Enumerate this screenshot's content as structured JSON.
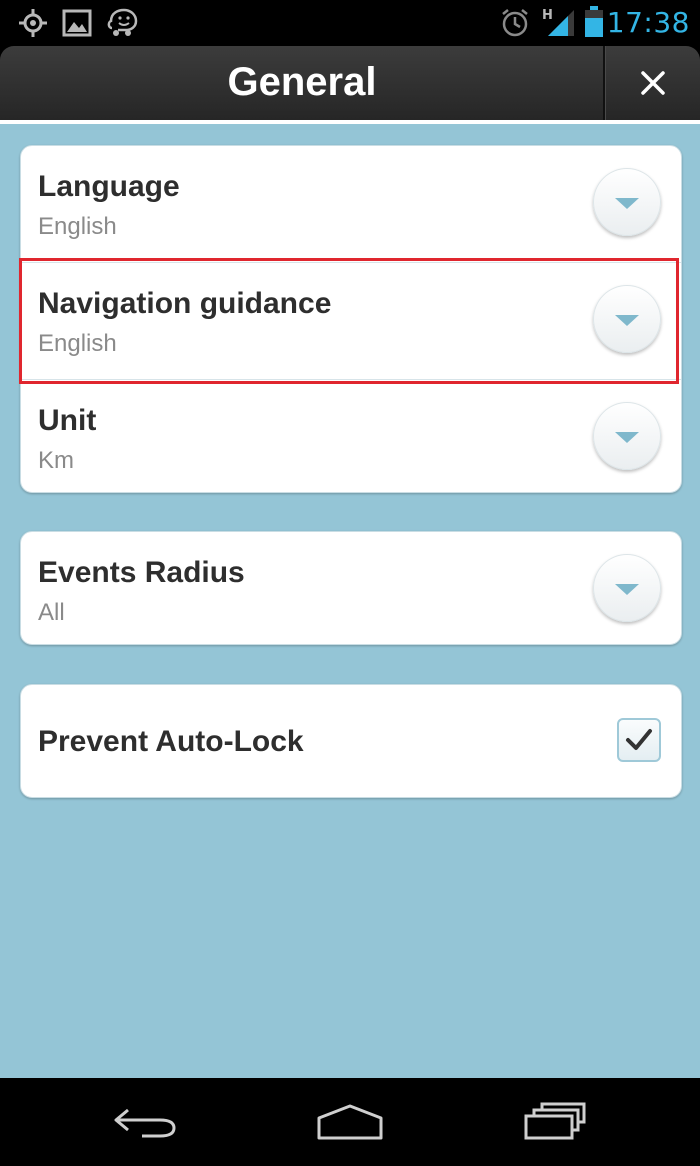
{
  "status_bar": {
    "time": "17:38",
    "network_type": "H",
    "left_icons": [
      "gps-icon",
      "gallery-icon",
      "waze-icon"
    ],
    "right_icons": [
      "alarm-icon",
      "signal-icon",
      "battery-icon"
    ]
  },
  "header": {
    "title": "General",
    "close_icon": "close-icon"
  },
  "settings": {
    "language": {
      "label": "Language",
      "value": "English"
    },
    "navigation_guidance": {
      "label": "Navigation guidance",
      "value": "English"
    },
    "unit": {
      "label": "Unit",
      "value": "Km"
    },
    "events_radius": {
      "label": "Events Radius",
      "value": "All"
    },
    "prevent_auto_lock": {
      "label": "Prevent Auto-Lock",
      "checked": true
    }
  },
  "nav_bar": {
    "icons": [
      "back-icon",
      "home-icon",
      "recent-apps-icon"
    ]
  },
  "colors": {
    "background": "#94c5d6",
    "highlight": "#e0262e",
    "status_accent": "#33b5e5"
  }
}
